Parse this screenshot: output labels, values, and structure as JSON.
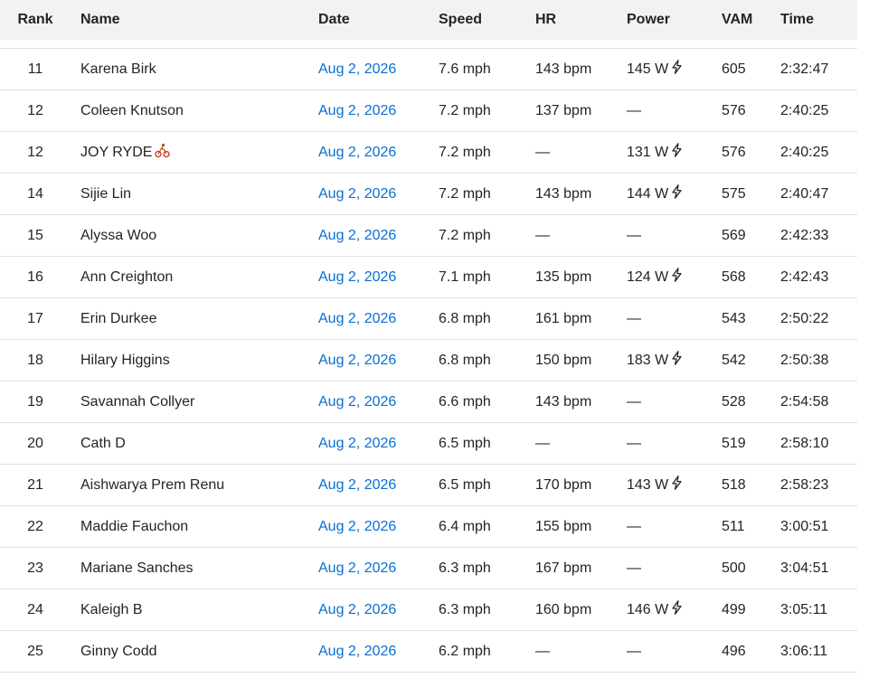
{
  "header": {
    "rank": "Rank",
    "name": "Name",
    "date": "Date",
    "speed": "Speed",
    "hr": "HR",
    "power": "Power",
    "vam": "VAM",
    "time": "Time"
  },
  "rows": [
    {
      "rank": "11",
      "name": "Karena Birk",
      "date": "Aug 2, 2026",
      "speed": "7.6 mph",
      "hr": "143 bpm",
      "power": "145 W",
      "power_meter": true,
      "vam": "605",
      "time": "2:32:47"
    },
    {
      "rank": "12",
      "name": "Coleen Knutson",
      "date": "Aug 2, 2026",
      "speed": "7.2 mph",
      "hr": "137 bpm",
      "power": "—",
      "power_meter": false,
      "vam": "576",
      "time": "2:40:25"
    },
    {
      "rank": "12",
      "name": "JOY RYDE",
      "name_icon": "cyclist-icon",
      "date": "Aug 2, 2026",
      "speed": "7.2 mph",
      "hr": "—",
      "power": "131 W",
      "power_meter": true,
      "vam": "576",
      "time": "2:40:25"
    },
    {
      "rank": "14",
      "name": "Sijie Lin",
      "date": "Aug 2, 2026",
      "speed": "7.2 mph",
      "hr": "143 bpm",
      "power": "144 W",
      "power_meter": true,
      "vam": "575",
      "time": "2:40:47"
    },
    {
      "rank": "15",
      "name": "Alyssa Woo",
      "date": "Aug 2, 2026",
      "speed": "7.2 mph",
      "hr": "—",
      "power": "—",
      "power_meter": false,
      "vam": "569",
      "time": "2:42:33"
    },
    {
      "rank": "16",
      "name": "Ann Creighton",
      "date": "Aug 2, 2026",
      "speed": "7.1 mph",
      "hr": "135 bpm",
      "power": "124 W",
      "power_meter": true,
      "vam": "568",
      "time": "2:42:43"
    },
    {
      "rank": "17",
      "name": "Erin Durkee",
      "date": "Aug 2, 2026",
      "speed": "6.8 mph",
      "hr": "161 bpm",
      "power": "—",
      "power_meter": false,
      "vam": "543",
      "time": "2:50:22"
    },
    {
      "rank": "18",
      "name": "Hilary Higgins",
      "date": "Aug 2, 2026",
      "speed": "6.8 mph",
      "hr": "150 bpm",
      "power": "183 W",
      "power_meter": true,
      "vam": "542",
      "time": "2:50:38"
    },
    {
      "rank": "19",
      "name": "Savannah Collyer",
      "date": "Aug 2, 2026",
      "speed": "6.6 mph",
      "hr": "143 bpm",
      "power": "—",
      "power_meter": false,
      "vam": "528",
      "time": "2:54:58"
    },
    {
      "rank": "20",
      "name": "Cath D",
      "date": "Aug 2, 2026",
      "speed": "6.5 mph",
      "hr": "—",
      "power": "—",
      "power_meter": false,
      "vam": "519",
      "time": "2:58:10"
    },
    {
      "rank": "21",
      "name": "Aishwarya Prem Renu",
      "date": "Aug 2, 2026",
      "speed": "6.5 mph",
      "hr": "170 bpm",
      "power": "143 W",
      "power_meter": true,
      "vam": "518",
      "time": "2:58:23"
    },
    {
      "rank": "22",
      "name": "Maddie Fauchon",
      "date": "Aug 2, 2026",
      "speed": "6.4 mph",
      "hr": "155 bpm",
      "power": "—",
      "power_meter": false,
      "vam": "511",
      "time": "3:00:51"
    },
    {
      "rank": "23",
      "name": "Mariane Sanches",
      "date": "Aug 2, 2026",
      "speed": "6.3 mph",
      "hr": "167 bpm",
      "power": "—",
      "power_meter": false,
      "vam": "500",
      "time": "3:04:51"
    },
    {
      "rank": "24",
      "name": "Kaleigh B",
      "date": "Aug 2, 2026",
      "speed": "6.3 mph",
      "hr": "160 bpm",
      "power": "146 W",
      "power_meter": true,
      "vam": "499",
      "time": "3:05:11"
    },
    {
      "rank": "25",
      "name": "Ginny Codd",
      "date": "Aug 2, 2026",
      "speed": "6.2 mph",
      "hr": "—",
      "power": "—",
      "power_meter": false,
      "vam": "496",
      "time": "3:06:11"
    }
  ],
  "colors": {
    "link": "#0a6ed1",
    "header_bg": "#f2f2f2",
    "text": "#242428",
    "divider": "#dfdfe8"
  },
  "icons": {
    "power_meter": "lightning-bolt-icon",
    "cyclist": "cyclist-icon"
  }
}
